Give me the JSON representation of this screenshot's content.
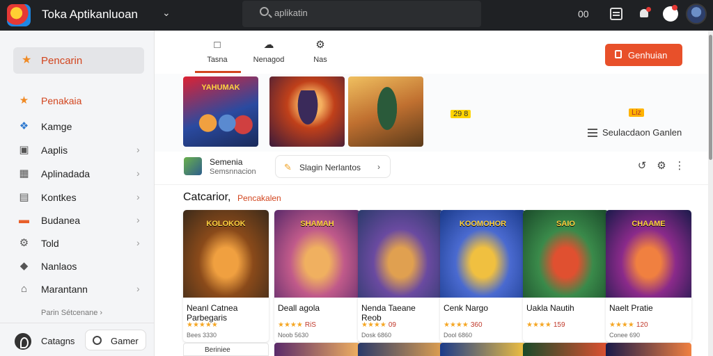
{
  "app": {
    "title": "Toka Aptikanluoan",
    "search_placeholder": "aplikatin",
    "top_count": "00"
  },
  "sidebar": {
    "primary": {
      "label": "Pencarin",
      "icon": "star-icon"
    },
    "items": [
      {
        "label": "Penakaia",
        "icon": "star-icon",
        "highlight": true,
        "chevron": false
      },
      {
        "label": "Kamge",
        "icon": "puzzle-icon",
        "chevron": false
      },
      {
        "label": "Aaplis",
        "icon": "image-icon",
        "chevron": true
      },
      {
        "label": "Aplinadada",
        "icon": "apps-icon",
        "chevron": true
      },
      {
        "label": "Kontkes",
        "icon": "calendar-icon",
        "chevron": true
      },
      {
        "label": "Budanea",
        "icon": "ticket-icon",
        "chevron": true
      },
      {
        "label": "Told",
        "icon": "gear-icon",
        "chevron": true
      },
      {
        "label": "Nanlaos",
        "icon": "tag-icon",
        "chevron": false
      },
      {
        "label": "Marantann",
        "icon": "home-icon",
        "chevron": true
      }
    ],
    "more_link": "Parin Sétcenane ›",
    "footer_label": "Catagns",
    "footer_button": "Gamer"
  },
  "tabs": [
    {
      "label": "Tasna",
      "icon": "bookmark-icon",
      "active": true
    },
    {
      "label": "Nenagod",
      "icon": "cloud-icon",
      "active": false
    },
    {
      "label": "Nas",
      "icon": "gear-icon",
      "active": false
    }
  ],
  "cta": {
    "label": "Genhuian"
  },
  "banner": {
    "heroes": [
      {
        "title": "YAHUMAK",
        "badge": ""
      },
      {
        "title": "",
        "badge": ""
      },
      {
        "title": "",
        "badge": ""
      }
    ],
    "chip_left": "29 8",
    "chip_right": "Liz",
    "link_label": "Seulacdaon Ganlen"
  },
  "app_bar": {
    "name": "Semenia",
    "sub": "Semsnnacion",
    "button_label": "Slagin Nerlantos",
    "chevron": "›"
  },
  "section": {
    "title": "Catcarior,",
    "subtitle": "Pencakalen"
  },
  "cards": [
    {
      "art_title": "KOLOKOK",
      "title_lines": [
        "Neanl Catnea",
        "Parbegaris"
      ],
      "stars": "★★★★★",
      "score": "",
      "meta": "Bees 3330",
      "colors": [
        "#3b2a1a",
        "#8a4a1a",
        "#f0a040"
      ]
    },
    {
      "art_title": "SHAMAH",
      "title_lines": [
        "Deall agola"
      ],
      "stars": "★★★★",
      "score": "RiS",
      "meta": "Noob 5630",
      "colors": [
        "#5a2a6a",
        "#c05a8a",
        "#f0b060"
      ]
    },
    {
      "art_title": "",
      "title_lines": [
        "Nenda Taeane",
        "Reob"
      ],
      "stars": "★★★★",
      "score": "09",
      "meta": "Dosk 6860",
      "colors": [
        "#2a3a6a",
        "#6a4aa0",
        "#e0a050"
      ]
    },
    {
      "art_title": "KOOMOHOR",
      "title_lines": [
        "Cenk Nargo"
      ],
      "stars": "★★★★",
      "score": "360",
      "meta": "Dool 6860",
      "colors": [
        "#1a3a8a",
        "#4a6ad0",
        "#f0c040"
      ]
    },
    {
      "art_title": "SAIO",
      "title_lines": [
        "Uakla Nautih"
      ],
      "stars": "★★★★",
      "score": "159",
      "meta": "",
      "colors": [
        "#1a4a2a",
        "#3a8a4a",
        "#e05030"
      ]
    },
    {
      "art_title": "CHAAME",
      "title_lines": [
        "Naelt Pratie"
      ],
      "stars": "★★★★",
      "score": "120",
      "meta": "Conee 690",
      "colors": [
        "#1a1a4a",
        "#8a2a8a",
        "#f08040"
      ]
    }
  ],
  "card_bottom_row": [
    {
      "label": "Beriniee"
    },
    {
      "label": ""
    },
    {
      "label": ""
    },
    {
      "label": ""
    },
    {
      "label": ""
    },
    {
      "label": ""
    }
  ]
}
